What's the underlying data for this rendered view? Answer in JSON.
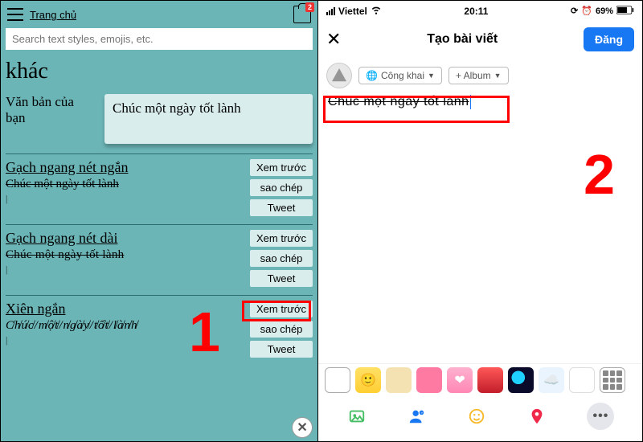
{
  "left": {
    "home_link": "Trang chủ",
    "clipboard_badge": "2",
    "search_placeholder": "Search text styles, emojis, etc.",
    "heading_word": "khác",
    "your_text_label": "Văn bản của bạn",
    "input_value": "Chúc một ngày tốt lành",
    "styles": [
      {
        "name": "Gạch ngang nét ngắn",
        "sample": "Chúc một ngày tốt lành",
        "sample_class": "strike-short"
      },
      {
        "name": "Gạch ngang nét dài",
        "sample": "Chúc một ngày tốt lành",
        "sample_class": "strike-long"
      },
      {
        "name": "Xiên ngắn",
        "sample": "C̸h̸ú̸c̸/m̸ộ̸t̸/n̸g̸à̸y̸/t̸ố̸t̸/l̸à̸n̸h̸",
        "sample_class": "slash-text"
      }
    ],
    "btn_preview": "Xem trước",
    "btn_copy": "sao chép",
    "btn_tweet": "Tweet",
    "step_number": "1"
  },
  "right": {
    "carrier": "Viettel",
    "time": "20:11",
    "battery": "69%",
    "nav_title": "Tạo bài viết",
    "post_label": "Đăng",
    "privacy_label": "Công khai",
    "album_label": "+ Album",
    "compose_text": "Chúc một ngày tốt lành",
    "step_number": "2"
  }
}
